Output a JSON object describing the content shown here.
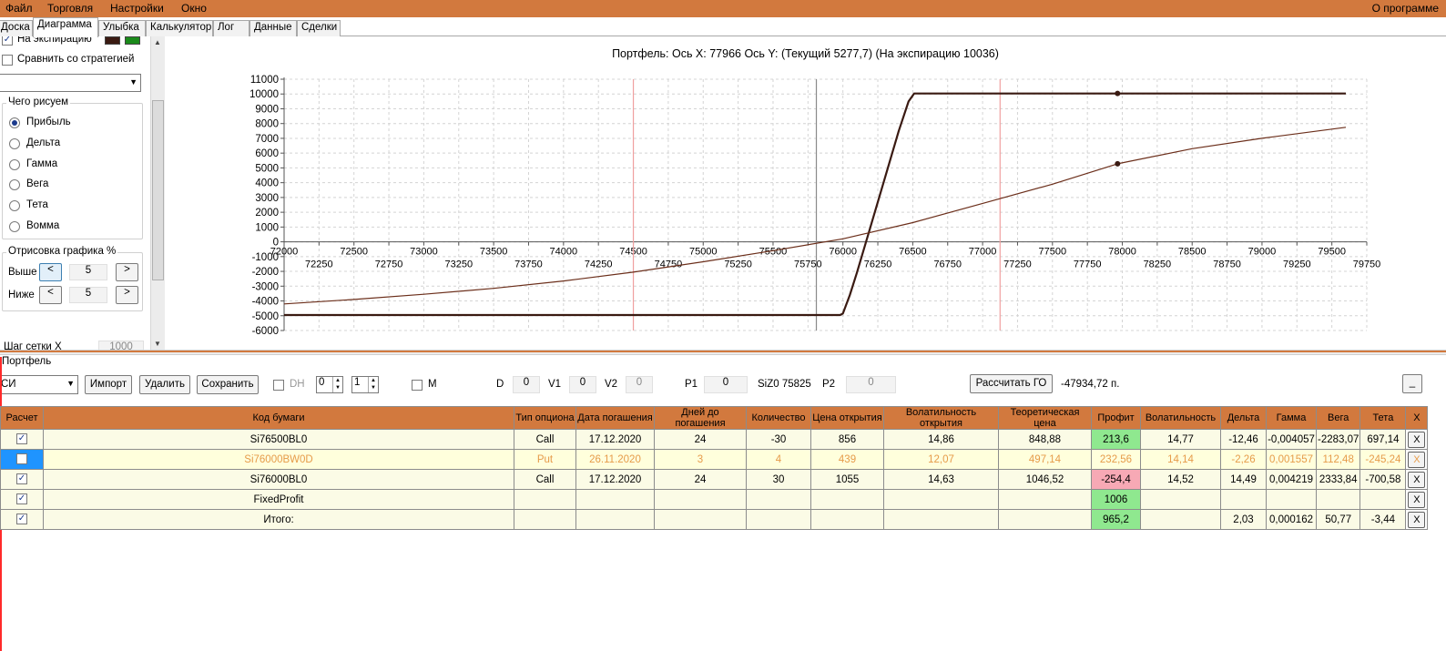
{
  "menu": {
    "items": [
      "Файл",
      "Торговля",
      "Настройки",
      "Окно"
    ],
    "right": "О программе"
  },
  "tabs": [
    "Доска",
    "Диаграмма",
    "Улыбка",
    "Калькулятор",
    "Лог",
    "Данные",
    "Сделки"
  ],
  "left_panel": {
    "expiration_label": "На экспирацию",
    "expiration_checked": true,
    "swatch_colors": [
      "#3a1a12",
      "#1a8a1a"
    ],
    "compare_label": "Сравнить со стратегией",
    "compare_checked": false,
    "group_title": "Чего рисуем",
    "radios": [
      "Прибыль",
      "Дельта",
      "Гамма",
      "Вега",
      "Тета",
      "Вомма"
    ],
    "radio_selected": 0,
    "render_title": "Отрисовка графика %",
    "above_label": "Выше",
    "above_value": "5",
    "below_label": "Ниже",
    "below_value": "5",
    "prev_glyph": "<",
    "next_glyph": ">",
    "grid_step_label": "Шаг сетки Х",
    "grid_step_value": "1000"
  },
  "chart_data": {
    "type": "line",
    "title": "Портфель: Ось X: 77966 Ось Y: (Текущий 5277,7) (На экспирацию 10036)",
    "xlim": [
      72000,
      79750
    ],
    "ylim": [
      -6000,
      11000
    ],
    "x_ticks_upper": [
      72000,
      72500,
      73000,
      73500,
      74000,
      74500,
      75000,
      75500,
      76000,
      76500,
      77000,
      77500,
      78000,
      78500,
      79000,
      79500
    ],
    "x_ticks_lower": [
      72250,
      72750,
      73250,
      73750,
      74250,
      74750,
      75250,
      75750,
      76250,
      76750,
      77250,
      77750,
      78250,
      78750,
      79250,
      79750
    ],
    "y_ticks": [
      11000,
      10000,
      9000,
      8000,
      7000,
      6000,
      5000,
      4000,
      3000,
      2000,
      1000,
      0,
      -1000,
      -2000,
      -3000,
      -4000,
      -5000,
      -6000
    ],
    "grid": true,
    "vlines": [
      {
        "x": 74500,
        "color": "#f0a0a0"
      },
      {
        "x": 75810,
        "color": "#8a8a8a"
      },
      {
        "x": 77125,
        "color": "#f0a0a0"
      }
    ],
    "series": [
      {
        "color": "#3a1a12",
        "points": [
          [
            72000,
            -4950
          ],
          [
            75980,
            -4950
          ],
          [
            76000,
            -4850
          ],
          [
            76050,
            -3600
          ],
          [
            76100,
            -2100
          ],
          [
            76200,
            1100
          ],
          [
            76300,
            4300
          ],
          [
            76400,
            7500
          ],
          [
            76470,
            9500
          ],
          [
            76510,
            10036
          ],
          [
            79600,
            10036
          ]
        ]
      },
      {
        "color": "#6b2e1a",
        "points": [
          [
            72000,
            -4200
          ],
          [
            72500,
            -3900
          ],
          [
            73000,
            -3550
          ],
          [
            73500,
            -3150
          ],
          [
            74000,
            -2650
          ],
          [
            74500,
            -2050
          ],
          [
            75000,
            -1350
          ],
          [
            75500,
            -600
          ],
          [
            76000,
            200
          ],
          [
            76500,
            1300
          ],
          [
            77000,
            2600
          ],
          [
            77500,
            3900
          ],
          [
            77966,
            5277.7
          ],
          [
            78500,
            6300
          ],
          [
            79000,
            7000
          ],
          [
            79600,
            7750
          ]
        ]
      }
    ],
    "markers": [
      [
        77966,
        10036
      ],
      [
        77966,
        5277.7
      ]
    ]
  },
  "portfolio": {
    "title": "Портфель",
    "combo_value": "СИ",
    "import_label": "Импорт",
    "delete_label": "Удалить",
    "save_label": "Сохранить",
    "dh_label": "DH",
    "dh_checked": false,
    "spin1": "0",
    "spin2": "1",
    "m_label": "M",
    "m_checked": false,
    "d_label": "D",
    "d_value": "0",
    "v1_label": "V1",
    "v1_value": "0",
    "v2_label": "V2",
    "v2_value": "0",
    "p1_label": "P1",
    "p1_value": "0",
    "siz_label": "SiZ0 75825",
    "p2_label": "P2",
    "p2_value": "0",
    "calc_label": "Рассчитать ГО",
    "go_value": "-47934,72 п.",
    "minimize_label": "_"
  },
  "table": {
    "headers": [
      "Расчет",
      "Код бумаги",
      "Тип опциона",
      "Дата погашения",
      "Дней до погашения",
      "Количество",
      "Цена открытия",
      "Волатильность открытия",
      "Теоретическая цена",
      "Профит",
      "Волатильность",
      "Дельта",
      "Гамма",
      "Вега",
      "Тета",
      "X"
    ],
    "rows": [
      {
        "checked": true,
        "cells": [
          "Si76500BL0",
          "Call",
          "17.12.2020",
          "24",
          "-30",
          "856",
          "14,86",
          "848,88",
          "213,6",
          "14,77",
          "-12,46",
          "-0,004057",
          "-2283,07",
          "697,14"
        ],
        "profit_style": "green"
      },
      {
        "checked": false,
        "cells": [
          "Si76000BW0D",
          "Put",
          "26.11.2020",
          "3",
          "4",
          "439",
          "12,07",
          "497,14",
          "232,56",
          "14,14",
          "-2,26",
          "0,001557",
          "112,48",
          "-245,24"
        ],
        "profit_style": "green",
        "dim": true
      },
      {
        "checked": true,
        "cells": [
          "Si76000BL0",
          "Call",
          "17.12.2020",
          "24",
          "30",
          "1055",
          "14,63",
          "1046,52",
          "-254,4",
          "14,52",
          "14,49",
          "0,004219",
          "2333,84",
          "-700,58"
        ],
        "profit_style": "pink"
      },
      {
        "checked": true,
        "cells": [
          "FixedProfit",
          "",
          "",
          "",
          "",
          "",
          "",
          "",
          "1006",
          "",
          "",
          "",
          "",
          ""
        ],
        "profit_style": "green"
      },
      {
        "checked": true,
        "cells": [
          "Итого:",
          "",
          "",
          "",
          "",
          "",
          "",
          "",
          "965,2",
          "",
          "2,03",
          "0,000162",
          "50,77",
          "-3,44"
        ],
        "profit_style": "green"
      }
    ],
    "delete_glyph": "X",
    "check_glyph": "✓"
  }
}
